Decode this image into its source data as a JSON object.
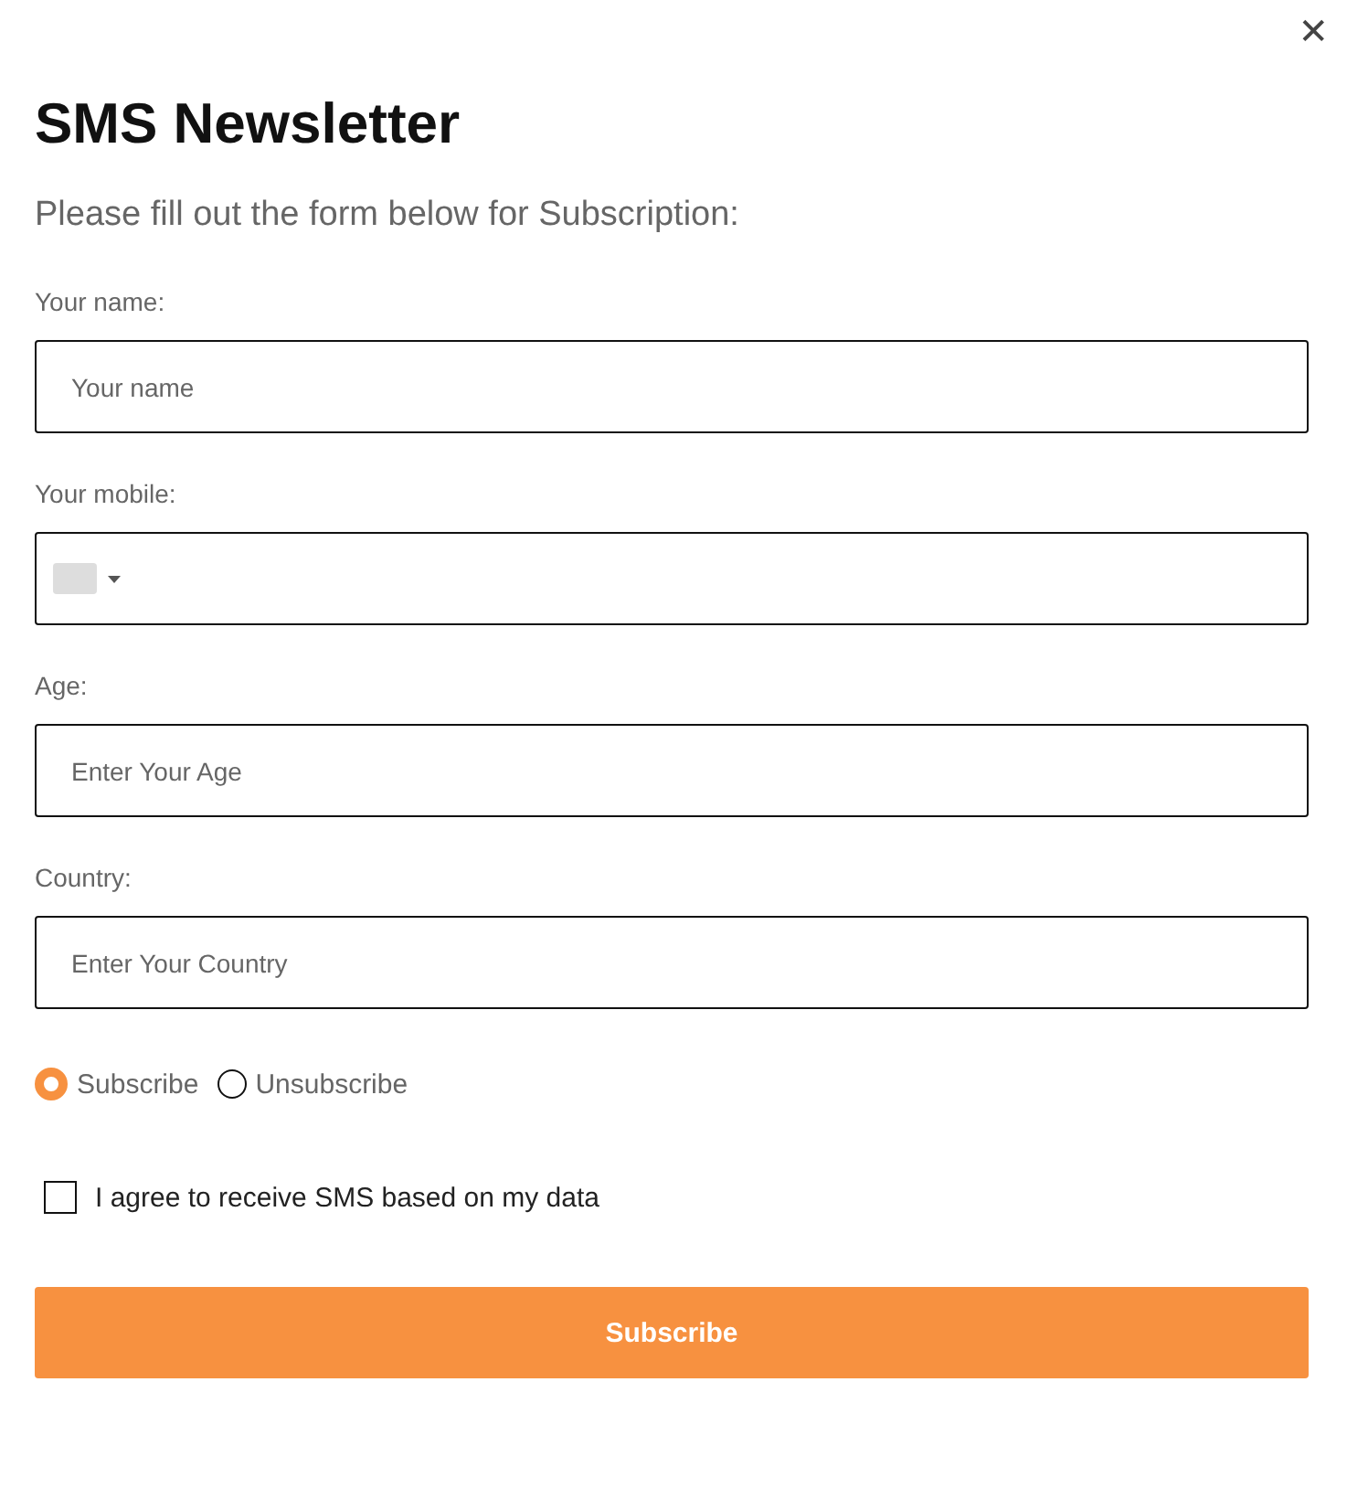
{
  "close": "✕",
  "title": "SMS Newsletter",
  "subtitle": "Please fill out the form below for Subscription:",
  "fields": [
    {
      "kind": "text",
      "label": "Your name:",
      "placeholder": "Your name"
    },
    {
      "kind": "phone",
      "label": "Your mobile:"
    },
    {
      "kind": "text",
      "label": "Age:",
      "placeholder": "Enter Your Age"
    },
    {
      "kind": "text",
      "label": "Country:",
      "placeholder": "Enter Your Country"
    }
  ],
  "options": [
    {
      "label": "Subscribe",
      "selected": true
    },
    {
      "label": "Unsubscribe",
      "selected": false
    }
  ],
  "consent": {
    "label": "I agree to receive SMS based on my data",
    "checked": false
  },
  "button": "Subscribe"
}
